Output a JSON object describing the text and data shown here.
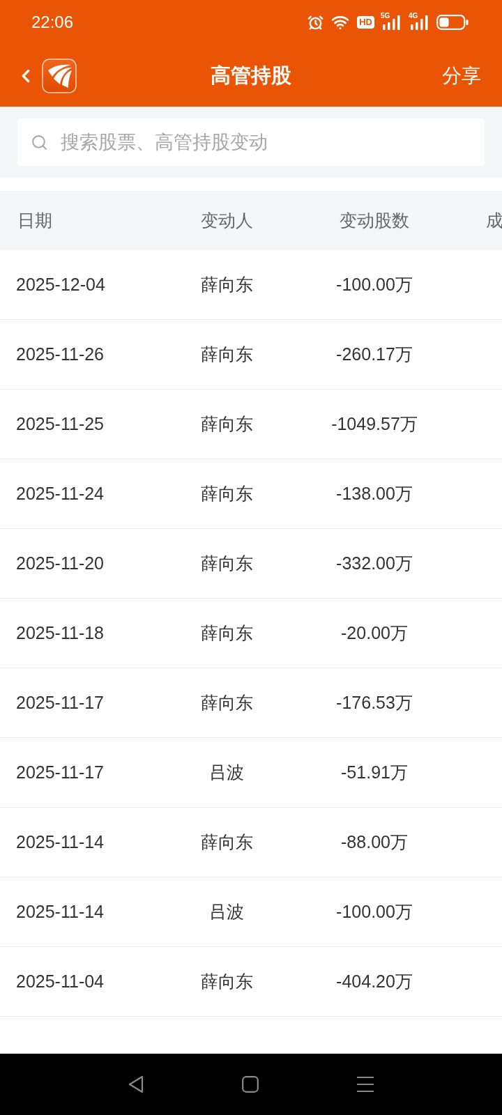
{
  "status_bar": {
    "time": "22:06",
    "hd_label": "HD",
    "network_1": "5G",
    "network_2": "4G"
  },
  "header": {
    "title": "高管持股",
    "action": "分享"
  },
  "search": {
    "placeholder": "搜索股票、高管持股变动"
  },
  "table": {
    "columns": [
      "日期",
      "变动人",
      "变动股数",
      "成"
    ],
    "rows": [
      {
        "date": "2025-12-04",
        "person": "薛向东",
        "shares": "-100.00万"
      },
      {
        "date": "2025-11-26",
        "person": "薛向东",
        "shares": "-260.17万"
      },
      {
        "date": "2025-11-25",
        "person": "薛向东",
        "shares": "-1049.57万"
      },
      {
        "date": "2025-11-24",
        "person": "薛向东",
        "shares": "-138.00万"
      },
      {
        "date": "2025-11-20",
        "person": "薛向东",
        "shares": "-332.00万"
      },
      {
        "date": "2025-11-18",
        "person": "薛向东",
        "shares": "-20.00万"
      },
      {
        "date": "2025-11-17",
        "person": "薛向东",
        "shares": "-176.53万"
      },
      {
        "date": "2025-11-17",
        "person": "吕波",
        "shares": "-51.91万"
      },
      {
        "date": "2025-11-14",
        "person": "薛向东",
        "shares": "-88.00万"
      },
      {
        "date": "2025-11-14",
        "person": "吕波",
        "shares": "-100.00万"
      },
      {
        "date": "2025-11-04",
        "person": "薛向东",
        "shares": "-404.20万"
      }
    ]
  }
}
